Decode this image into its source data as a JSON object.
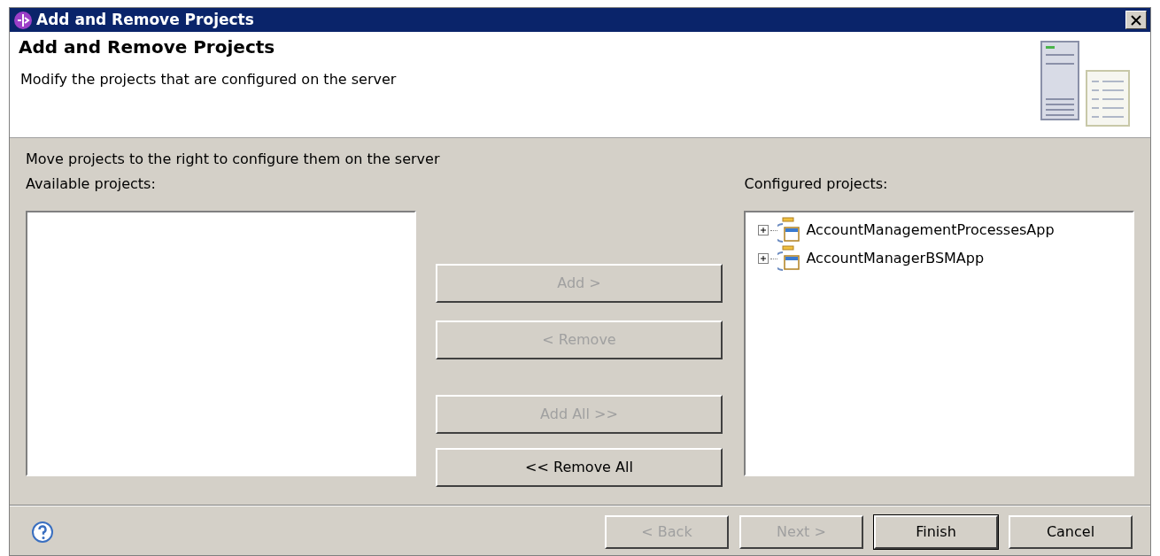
{
  "window": {
    "title": "Add and Remove Projects"
  },
  "header": {
    "title": "Add and Remove Projects",
    "description": "Modify the projects that are configured on the server"
  },
  "instruction": "Move projects to the right to configure them on the server",
  "available": {
    "label": "Available projects:"
  },
  "configured": {
    "label": "Configured projects:",
    "items": [
      {
        "label": "AccountManagementProcessesApp",
        "expanded": false
      },
      {
        "label": "AccountManagerBSMApp",
        "expanded": false
      }
    ]
  },
  "move_buttons": [
    {
      "label": "Add >",
      "disabled": true
    },
    {
      "label": "< Remove",
      "disabled": true
    },
    {
      "label": "Add All >>",
      "disabled": true
    },
    {
      "label": "<< Remove All",
      "disabled": false
    }
  ],
  "footer_buttons": [
    {
      "label": "< Back",
      "disabled": true,
      "default": false
    },
    {
      "label": "Next >",
      "disabled": true,
      "default": false
    },
    {
      "label": "Finish",
      "disabled": false,
      "default": true
    },
    {
      "label": "Cancel",
      "disabled": false,
      "default": false
    }
  ]
}
